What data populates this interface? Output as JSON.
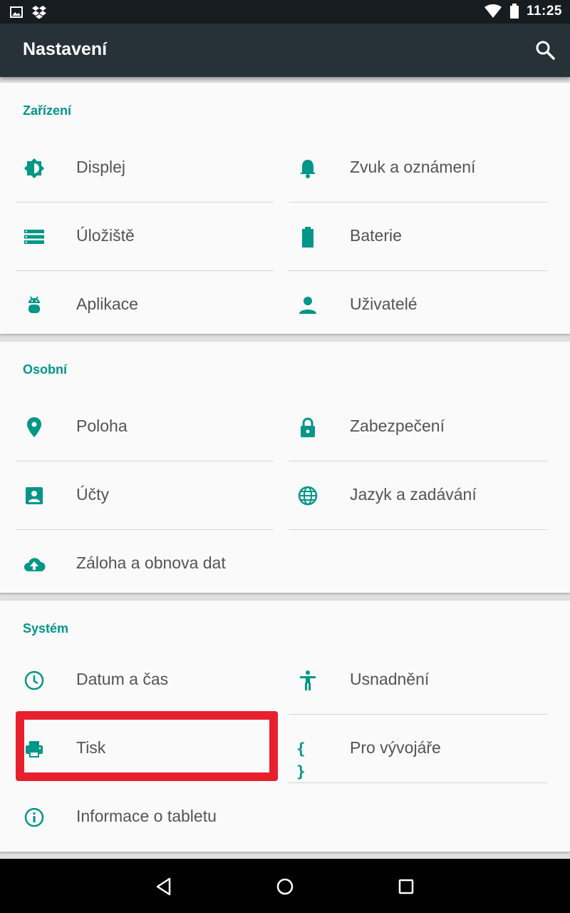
{
  "status_bar": {
    "time": "11:25",
    "left_icons": [
      "image-icon",
      "dropbox-icon"
    ],
    "right_icons": [
      "wifi-icon",
      "battery-icon"
    ]
  },
  "app_bar": {
    "title": "Nastavení",
    "action_icon": "search-icon"
  },
  "sections": [
    {
      "title": "Zařízení",
      "items": [
        {
          "label": "Displej",
          "icon": "brightness-icon"
        },
        {
          "label": "Zvuk a oznámení",
          "icon": "bell-icon"
        },
        {
          "label": "Úložiště",
          "icon": "storage-icon"
        },
        {
          "label": "Baterie",
          "icon": "battery-icon"
        },
        {
          "label": "Aplikace",
          "icon": "android-icon"
        },
        {
          "label": "Uživatelé",
          "icon": "person-icon"
        }
      ]
    },
    {
      "title": "Osobní",
      "items": [
        {
          "label": "Poloha",
          "icon": "location-icon"
        },
        {
          "label": "Zabezpečení",
          "icon": "lock-icon"
        },
        {
          "label": "Účty",
          "icon": "account-box-icon"
        },
        {
          "label": "Jazyk a zadávání",
          "icon": "globe-icon"
        },
        {
          "label": "Záloha a obnova dat",
          "icon": "cloud-upload-icon"
        }
      ]
    },
    {
      "title": "Systém",
      "items": [
        {
          "label": "Datum a čas",
          "icon": "clock-icon"
        },
        {
          "label": "Usnadnění",
          "icon": "accessibility-icon"
        },
        {
          "label": "Tisk",
          "icon": "printer-icon"
        },
        {
          "label": "Pro vývojáře",
          "icon": "braces-icon",
          "glyph": "{ }"
        },
        {
          "label": "Informace o tabletu",
          "icon": "info-icon"
        }
      ]
    }
  ],
  "nav_bar": {
    "buttons": [
      "back-icon",
      "home-icon",
      "recents-icon"
    ]
  },
  "colors": {
    "accent": "#009688",
    "app_bar": "#263238",
    "status_bar": "#161c20",
    "highlight": "#e8202e",
    "text": "#545454"
  }
}
